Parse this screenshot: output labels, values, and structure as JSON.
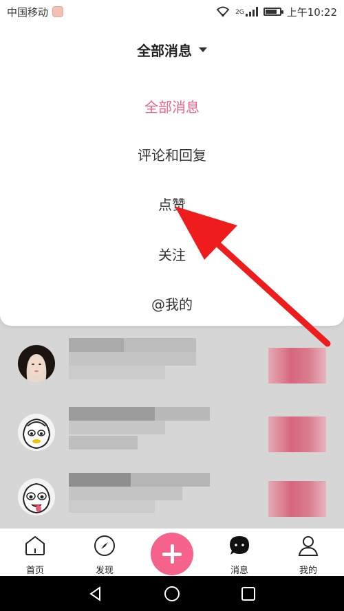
{
  "status_bar": {
    "carrier": "中国移动",
    "network": "2G",
    "time": "上午10:22"
  },
  "dropdown": {
    "header_title": "全部消息",
    "items": [
      {
        "label": "全部消息",
        "active": true
      },
      {
        "label": "评论和回复",
        "active": false
      },
      {
        "label": "点赞",
        "active": false
      },
      {
        "label": "关注",
        "active": false
      },
      {
        "label": "@我的",
        "active": false
      }
    ]
  },
  "bottom_nav": {
    "items": [
      {
        "label": "首页",
        "icon": "home-icon"
      },
      {
        "label": "发现",
        "icon": "compass-icon"
      },
      {
        "label": "",
        "icon": "plus-icon"
      },
      {
        "label": "消息",
        "icon": "chat-bubble-icon"
      },
      {
        "label": "我的",
        "icon": "person-icon"
      }
    ]
  },
  "colors": {
    "accent": "#ef6287",
    "plus_button": "#f5628b",
    "annotation_arrow": "#ee1c1c"
  }
}
